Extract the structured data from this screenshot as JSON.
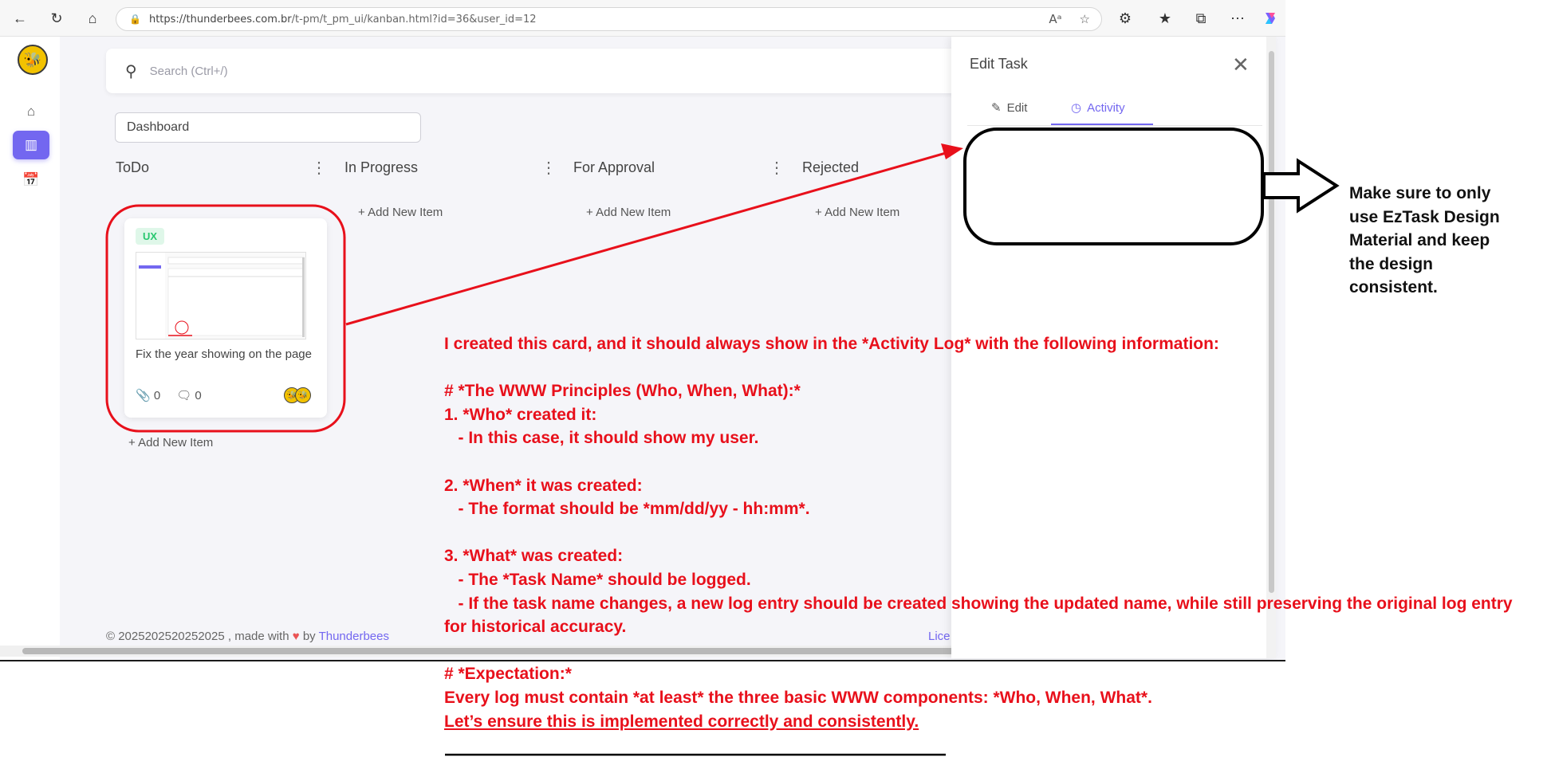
{
  "browser": {
    "url_host": "https://thunderbees.com.br",
    "url_path": "/t-pm/t_pm_ui/kanban.html?id=36&user_id=12"
  },
  "app": {
    "search_placeholder": "Search (Ctrl+/)",
    "board_name": "Dashboard",
    "columns": [
      {
        "title": "ToDo",
        "add_label": "+ Add New Item"
      },
      {
        "title": "In Progress",
        "add_label": "+ Add New Item"
      },
      {
        "title": "For Approval",
        "add_label": "+ Add New Item"
      },
      {
        "title": "Rejected",
        "add_label": "+ Add New Item"
      }
    ],
    "card": {
      "tag": "UX",
      "title": "Fix the year showing on the page",
      "attachments": "0",
      "comments": "0"
    },
    "footer": {
      "copyright": "© 2025202520252025 , made with",
      "by": "by",
      "brand": "Thunderbees",
      "license": "Lice"
    }
  },
  "drawer": {
    "title": "Edit Task",
    "tabs": [
      {
        "label": "Edit",
        "icon": "edit-icon"
      },
      {
        "label": "Activity",
        "icon": "clock-icon",
        "active": true
      }
    ]
  },
  "annotation": {
    "main_text": "I created this card, and it should always show in the *Activity Log* with the following information:\n\n# *The WWW Principles (Who, When, What):*\n1. *Who* created it:\n   - In this case, it should show my user.\n\n2. *When* it was created:\n   - The format should be *mm/dd/yy - hh:mm*.\n\n3. *What* was created:\n   - The *Task Name* should be logged.\n   - If the task name changes, a new log entry should be created showing the updated name, while still preserving the original log entry\nfor historical accuracy.\n\n# *Expectation:*\nEvery log must contain *at least* the three basic WWW components: *Who, When, What*.\n",
    "final_line": "Let’s ensure this is implemented correctly and consistently.",
    "side_note": "Make sure to only use EzTask Design Material and keep the design consistent."
  },
  "colors": {
    "accent": "#7367f0",
    "annotation_red": "#e8101b",
    "tag_green": "#28c76f"
  }
}
